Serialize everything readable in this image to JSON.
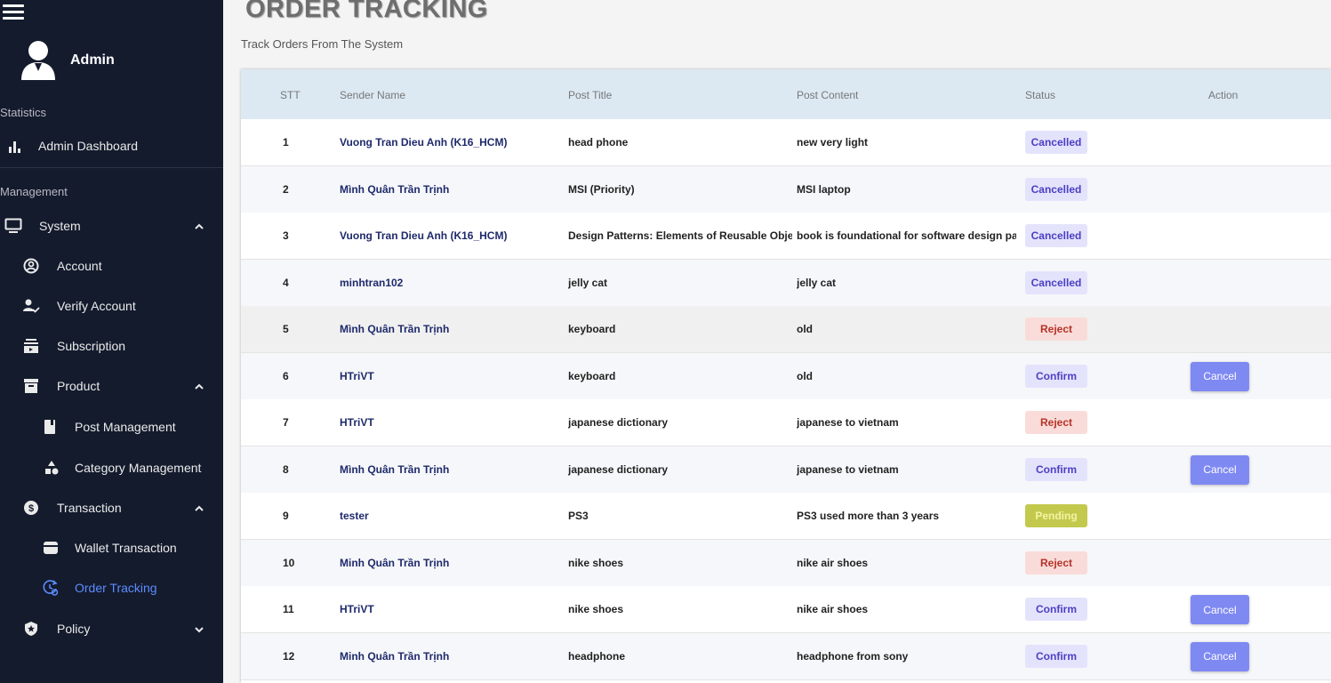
{
  "sidebar": {
    "admin_name": "Admin",
    "sections": {
      "statistics": "Statistics",
      "management": "Management"
    },
    "items": {
      "admin_dashboard": "Admin Dashboard",
      "system": "System",
      "account": "Account",
      "verify_account": "Verify Account",
      "subscription": "Subscription",
      "product": "Product",
      "post_management": "Post Management",
      "category_management": "Category Management",
      "transaction": "Transaction",
      "wallet_transaction": "Wallet Transaction",
      "order_tracking": "Order Tracking",
      "policy": "Policy"
    },
    "active_color": "#5b8cff"
  },
  "header": {
    "title": "ORDER TRACKING",
    "subtitle": "Track Orders From The System"
  },
  "table": {
    "columns": {
      "stt": "STT",
      "sender": "Sender Name",
      "title": "Post Title",
      "content": "Post Content",
      "status": "Status",
      "action": "Action"
    },
    "cancel_label": "Cancel",
    "rows": [
      {
        "stt": "1",
        "sender": "Vuong Tran Dieu Anh (K16_HCM)",
        "title": "head phone",
        "content": "new very light",
        "status": "Cancelled",
        "status_type": "cancelled",
        "action": false
      },
      {
        "stt": "2",
        "sender": "Mình Quân Trần Trịnh",
        "title": "MSI (Priority)",
        "content": "MSI laptop",
        "status": "Cancelled",
        "status_type": "cancelled",
        "action": false
      },
      {
        "stt": "3",
        "sender": "Vuong Tran Dieu Anh (K16_HCM)",
        "title": "Design Patterns: Elements of Reusable Object-O",
        "content": "book is foundational for software design patterr",
        "status": "Cancelled",
        "status_type": "cancelled",
        "action": false
      },
      {
        "stt": "4",
        "sender": "minhtran102",
        "title": "jelly cat",
        "content": "jelly cat",
        "status": "Cancelled",
        "status_type": "cancelled",
        "action": false
      },
      {
        "stt": "5",
        "sender": "Mình Quân Trần Trịnh",
        "title": "keyboard",
        "content": "old",
        "status": "Reject",
        "status_type": "reject",
        "action": false
      },
      {
        "stt": "6",
        "sender": "HTriVT",
        "title": "keyboard",
        "content": "old",
        "status": "Confirm",
        "status_type": "confirm",
        "action": true
      },
      {
        "stt": "7",
        "sender": "HTriVT",
        "title": "japanese dictionary",
        "content": "japanese to vietnam",
        "status": "Reject",
        "status_type": "reject",
        "action": false
      },
      {
        "stt": "8",
        "sender": "Mình Quân Trần Trịnh",
        "title": "japanese dictionary",
        "content": "japanese to vietnam",
        "status": "Confirm",
        "status_type": "confirm",
        "action": true
      },
      {
        "stt": "9",
        "sender": "tester",
        "title": "PS3",
        "content": "PS3 used more than 3 years",
        "status": "Pending",
        "status_type": "pending",
        "action": false
      },
      {
        "stt": "10",
        "sender": "Minh Quân Trần Trịnh",
        "title": "nike shoes",
        "content": "nike air shoes",
        "status": "Reject",
        "status_type": "reject",
        "action": false
      },
      {
        "stt": "11",
        "sender": "HTriVT",
        "title": "nike shoes",
        "content": "nike air shoes",
        "status": "Confirm",
        "status_type": "confirm",
        "action": true
      },
      {
        "stt": "12",
        "sender": "Minh Quân Trần Trịnh",
        "title": "headphone",
        "content": "headphone from sony",
        "status": "Confirm",
        "status_type": "confirm",
        "action": true
      }
    ]
  }
}
